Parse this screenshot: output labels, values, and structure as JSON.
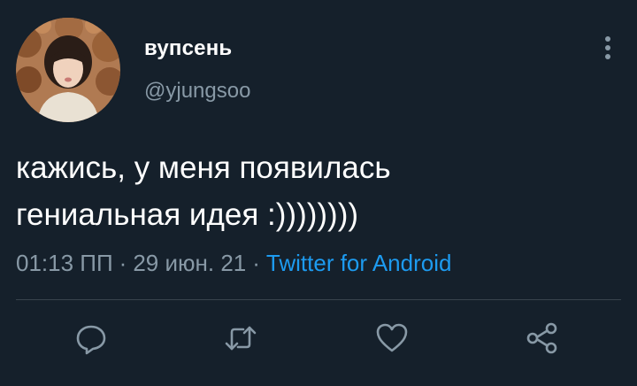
{
  "tweet": {
    "display_name": "вупсень",
    "handle": "@yjungsoo",
    "text": "кажись, у меня появилась\nгениальная идея :))))))))",
    "time": "01:13 ПП",
    "separator": "·",
    "date": "29 июн. 21",
    "source": "Twitter for Android"
  },
  "icons": {
    "more": "more-vertical-icon",
    "reply": "reply-icon",
    "retweet": "retweet-icon",
    "like": "heart-icon",
    "share": "share-icon"
  },
  "colors": {
    "background": "#15202b",
    "text": "#ffffff",
    "secondary": "#8899a6",
    "link": "#1d9bf0",
    "divider": "#38444d"
  }
}
